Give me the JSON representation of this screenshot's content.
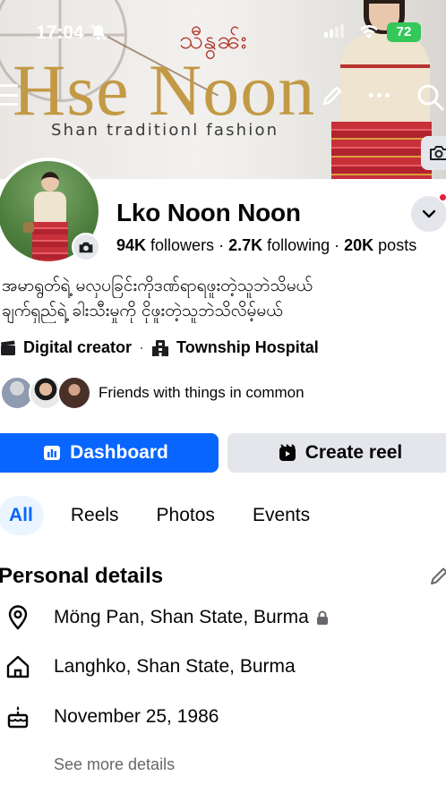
{
  "status_bar": {
    "time": "17:04",
    "battery": "72"
  },
  "cover": {
    "script_title": "သီနွၼ်း",
    "title": "Hse Noon",
    "subtitle": "Shan traditionl fashion"
  },
  "profile": {
    "name": "Lko Noon Noon",
    "stats": {
      "followers_count": "94K",
      "followers_label": " followers",
      "following_count": "2.7K",
      "following_label": " following",
      "posts_count": "20K",
      "posts_label": " posts",
      "separator": " · "
    },
    "bio": [
      "အမာရွတ်ရဲ့ မလှပခြင်းကိုဒဏ်ရာရဖူးတဲ့သူဘဲသိမယ်",
      "ချက်ရှည်ရဲ့ ခါးသီးမှုကို ငိုဖူးတဲ့သူဘဲသိလိမ့်မယ်"
    ],
    "category": "Digital creator",
    "category_separator": "·",
    "workplace": "Township Hospital",
    "friends_text": "Friends with things in common"
  },
  "actions": {
    "dashboard_label": "Dashboard",
    "create_reel_label": "Create reel"
  },
  "tabs": [
    {
      "label": "All",
      "active": true
    },
    {
      "label": "Reels",
      "active": false
    },
    {
      "label": "Photos",
      "active": false
    },
    {
      "label": "Events",
      "active": false
    }
  ],
  "personal_details": {
    "title": "Personal details",
    "location": "Möng Pan, Shan State, Burma",
    "hometown": "Langhko, Shan State, Burma",
    "birthday": "November 25, 1986",
    "see_more": "See more details"
  },
  "colors": {
    "accent": "#0866ff",
    "button_secondary": "#e4e6eb",
    "notification": "#e41e3f",
    "battery": "#34c759"
  },
  "icons": [
    "bell-off-icon",
    "signal-icon",
    "wifi-icon",
    "menu-icon",
    "edit-icon",
    "more-icon",
    "search-icon",
    "camera-icon",
    "chevron-down-icon",
    "clapperboard-icon",
    "building-icon",
    "dashboard-icon",
    "reel-icon",
    "pencil-icon",
    "location-pin-icon",
    "home-icon",
    "birthday-cake-icon",
    "lock-icon"
  ]
}
